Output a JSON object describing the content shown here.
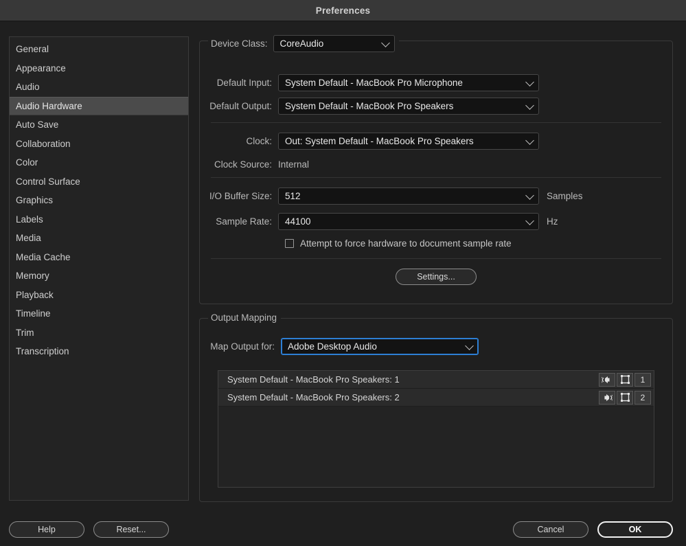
{
  "window": {
    "title": "Preferences"
  },
  "sidebar": {
    "items": [
      {
        "label": "General",
        "selected": false
      },
      {
        "label": "Appearance",
        "selected": false
      },
      {
        "label": "Audio",
        "selected": false
      },
      {
        "label": "Audio Hardware",
        "selected": true
      },
      {
        "label": "Auto Save",
        "selected": false
      },
      {
        "label": "Collaboration",
        "selected": false
      },
      {
        "label": "Color",
        "selected": false
      },
      {
        "label": "Control Surface",
        "selected": false
      },
      {
        "label": "Graphics",
        "selected": false
      },
      {
        "label": "Labels",
        "selected": false
      },
      {
        "label": "Media",
        "selected": false
      },
      {
        "label": "Media Cache",
        "selected": false
      },
      {
        "label": "Memory",
        "selected": false
      },
      {
        "label": "Playback",
        "selected": false
      },
      {
        "label": "Timeline",
        "selected": false
      },
      {
        "label": "Trim",
        "selected": false
      },
      {
        "label": "Transcription",
        "selected": false
      }
    ]
  },
  "device_group": {
    "legend": "Device Class:",
    "device_class_value": "CoreAudio",
    "default_input_label": "Default Input:",
    "default_input_value": "System Default - MacBook Pro Microphone",
    "default_output_label": "Default Output:",
    "default_output_value": "System Default - MacBook Pro Speakers",
    "clock_label": "Clock:",
    "clock_value": "Out: System Default - MacBook Pro Speakers",
    "clock_source_label": "Clock Source:",
    "clock_source_value": "Internal",
    "buffer_label": "I/O Buffer Size:",
    "buffer_value": "512",
    "buffer_unit": "Samples",
    "sample_rate_label": "Sample Rate:",
    "sample_rate_value": "44100",
    "sample_rate_unit": "Hz",
    "force_hw_checkbox_label": "Attempt to force hardware to document sample rate",
    "force_hw_checked": false,
    "settings_button": "Settings..."
  },
  "output_mapping": {
    "legend": "Output Mapping",
    "map_output_for_label": "Map Output for:",
    "map_output_for_value": "Adobe Desktop Audio",
    "rows": [
      {
        "name": "System Default - MacBook Pro Speakers: 1",
        "pan_icon": "speaker-left-icon",
        "clip-icon": "channel-bracket-icon",
        "channel": "1"
      },
      {
        "name": "System Default - MacBook Pro Speakers: 2",
        "pan_icon": "speaker-right-icon",
        "clip-icon": "channel-bracket-icon",
        "channel": "2"
      }
    ]
  },
  "footer": {
    "help": "Help",
    "reset": "Reset...",
    "cancel": "Cancel",
    "ok": "OK"
  },
  "colors": {
    "window_bg": "#1f1f1f",
    "titlebar_bg": "#383838",
    "panel_bg": "#232323",
    "selected_item": "#4b4b4b",
    "field_bg": "#131313",
    "focus_accent": "#2d7fd4",
    "text": "#c8c8c8"
  }
}
